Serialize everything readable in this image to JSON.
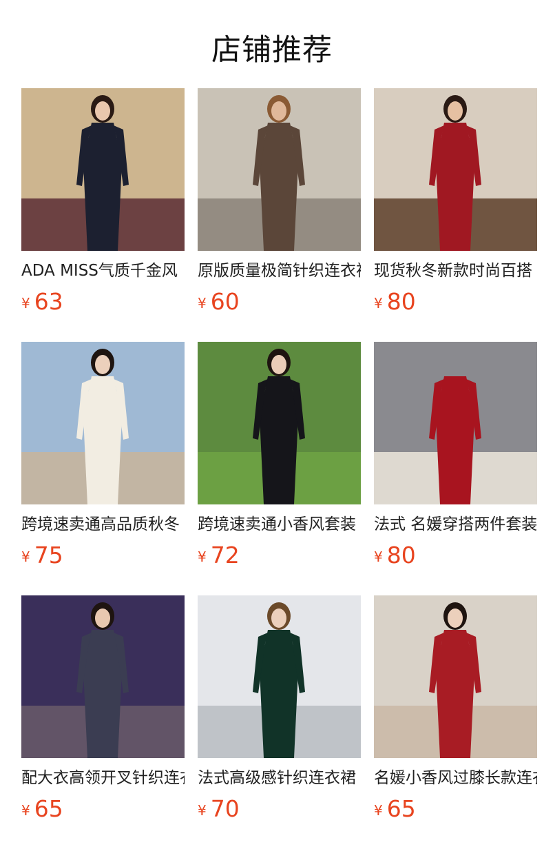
{
  "header": {
    "title": "店铺推荐"
  },
  "products": [
    {
      "name": "ADA MISS气质千金风",
      "currency": "¥",
      "price": "63",
      "bg": "#cdb58f",
      "floor": "#5a2d35",
      "dress": "#1c2030",
      "skin": "#e9c7ad",
      "hair": "#2a1a14",
      "icon": "product-photo"
    },
    {
      "name": "原版质量极简针织连衣裙",
      "currency": "¥",
      "price": "60",
      "bg": "#c9c2b6",
      "floor": "#8b8379",
      "dress": "#5b4639",
      "skin": "#e0b89a",
      "hair": "#8a5a34",
      "icon": "product-photo"
    },
    {
      "name": "现货秋冬新款时尚百搭",
      "currency": "¥",
      "price": "80",
      "bg": "#d8cdbf",
      "floor": "#5e3f2a",
      "dress": "#a01822",
      "skin": "#e6c0a2",
      "hair": "#2a1a14",
      "icon": "product-photo"
    },
    {
      "name": "跨境速卖通高品质秋冬",
      "currency": "¥",
      "price": "75",
      "bg": "#9fb9d4",
      "floor": "#c8b49a",
      "dress": "#f2ede2",
      "skin": "#ecd0bc",
      "hair": "#1e1410",
      "icon": "product-photo"
    },
    {
      "name": "跨境速卖通小香风套装",
      "currency": "¥",
      "price": "72",
      "bg": "#5d8b3f",
      "floor": "#6fa344",
      "dress": "#15151a",
      "skin": "#ebcdb8",
      "hair": "#1e1410",
      "icon": "product-photo"
    },
    {
      "name": "法式 名媛穿搭两件套装",
      "currency": "¥",
      "price": "80",
      "bg": "#8a8a8f",
      "floor": "#ece6dc",
      "dress": "#a8141f",
      "skin": "#8a8a8f",
      "hair": "#8a8a8f",
      "icon": "product-photo"
    },
    {
      "name": "配大衣高领开叉针织连衣裙",
      "currency": "¥",
      "price": "65",
      "bg": "#3a2f5a",
      "floor": "#6a5a6a",
      "dress": "#3b3d52",
      "skin": "#e8c8b0",
      "hair": "#1e1410",
      "icon": "product-photo"
    },
    {
      "name": "法式高级感针织连衣裙",
      "currency": "¥",
      "price": "70",
      "bg": "#e4e6ea",
      "floor": "#b9bcc2",
      "dress": "#113328",
      "skin": "#ecd0bc",
      "hair": "#6b4a2a",
      "icon": "product-photo"
    },
    {
      "name": "名媛小香风过膝长款连衣裙",
      "currency": "¥",
      "price": "65",
      "bg": "#d9d2c8",
      "floor": "#c9b8a6",
      "dress": "#a81c24",
      "skin": "#ecd0bc",
      "hair": "#1e1410",
      "icon": "product-photo"
    }
  ]
}
